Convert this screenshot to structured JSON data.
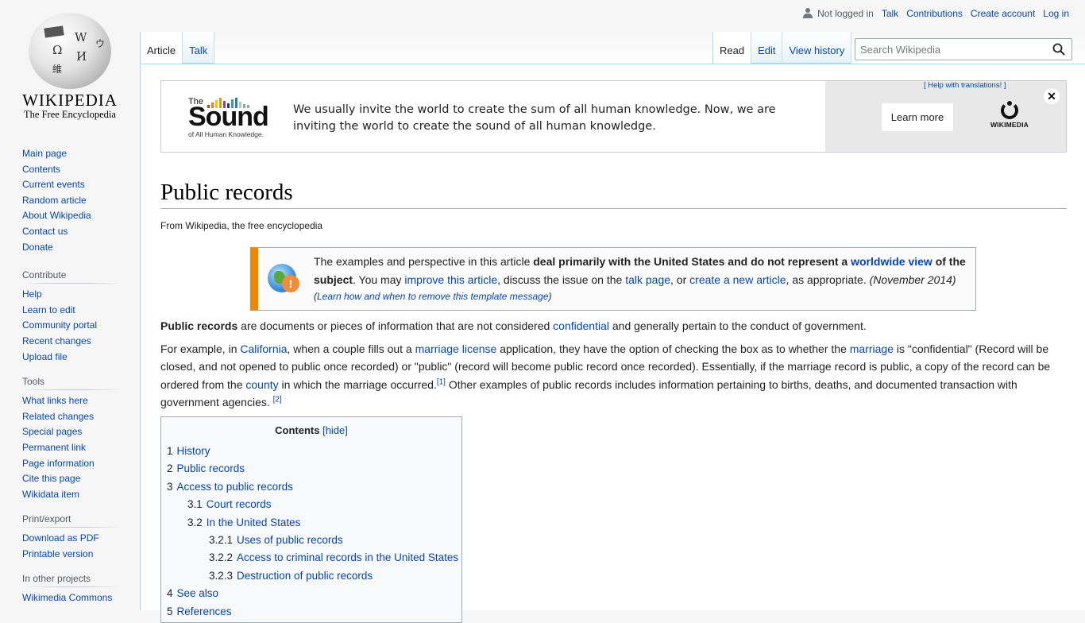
{
  "logo": {
    "wordmark": "WIKIPEDIA",
    "tagline": "The Free Encyclopedia",
    "globe_glyphs": [
      "Ω",
      "W",
      "И",
      "維",
      "ウ"
    ]
  },
  "personal": {
    "status": "Not logged in",
    "links": [
      "Talk",
      "Contributions",
      "Create account",
      "Log in"
    ]
  },
  "tabs": {
    "left": [
      {
        "label": "Article",
        "selected": true
      },
      {
        "label": "Talk",
        "selected": false
      }
    ],
    "right": [
      {
        "label": "Read",
        "selected": true
      },
      {
        "label": "Edit",
        "selected": false
      },
      {
        "label": "View history",
        "selected": false
      }
    ]
  },
  "search": {
    "placeholder": "Search Wikipedia",
    "value": ""
  },
  "sidebar": {
    "navigation": [
      "Main page",
      "Contents",
      "Current events",
      "Random article",
      "About Wikipedia",
      "Contact us",
      "Donate"
    ],
    "contribute": {
      "heading": "Contribute",
      "items": [
        "Help",
        "Learn to edit",
        "Community portal",
        "Recent changes",
        "Upload file"
      ]
    },
    "tools": {
      "heading": "Tools",
      "items": [
        "What links here",
        "Related changes",
        "Special pages",
        "Permanent link",
        "Page information",
        "Cite this page",
        "Wikidata item"
      ]
    },
    "print": {
      "heading": "Print/export",
      "items": [
        "Download as PDF",
        "Printable version"
      ]
    },
    "other_projects": {
      "heading": "In other projects",
      "items": [
        "Wikimedia Commons"
      ]
    }
  },
  "banner": {
    "logo_the": "The",
    "logo_word": "Sound",
    "logo_sub": "of All Human Knowledge.",
    "bar_colors": [
      "#c0392b",
      "#e67e22",
      "#f1c40f",
      "#d4a017",
      "#8e44ad",
      "#2c3e50",
      "#3498db",
      "#2980b9",
      "#bdc3c7",
      "#95a5a6",
      "#7fb3a0"
    ],
    "message": "We usually invite the world to create the sum of all human knowledge. Now, we are inviting the world to create the sound of all human knowledge.",
    "help_link": "[ Help with translations! ]",
    "learn_more": "Learn more",
    "org": "WIKIMEDIA",
    "close": "✕"
  },
  "article": {
    "title": "Public records",
    "site_sub": "From Wikipedia, the free encyclopedia"
  },
  "ambox": {
    "t1": "The examples and perspective in this article ",
    "bold1": "deal primarily with the United States and do not represent a ",
    "link1": "worldwide view",
    "bold2": " of the subject",
    "t2": ". You may ",
    "link2": "improve this article",
    "t3": ", discuss the issue on the ",
    "link3": "talk page",
    "t4": ", or ",
    "link4": "create a new article",
    "t5": ", as appropriate. ",
    "date": "(November 2014)",
    "learn_open": "(",
    "learn_link": "Learn how and when to remove this template message",
    "learn_close": ")",
    "warn_glyph": "!"
  },
  "para1": {
    "bold": "Public records",
    "t1": " are documents or pieces of information that are not considered ",
    "link1": "confidential",
    "t2": " and generally pertain to the conduct of government."
  },
  "para2": {
    "t1": "For example, in ",
    "link1": "California",
    "t2": ", when a couple fills out a ",
    "link2": "marriage license",
    "t3": " application, they have the option of checking the box as to whether the ",
    "link3": "marriage",
    "t4": " is \"confidential\" (Record will be closed, and not opened to public once recorded) or \"public\" (record will become public record once recorded). Essentially, if the marriage record is public, a copy of the record can be ordered from the ",
    "link4": "county",
    "t5": " in which the marriage occurred.",
    "ref1": "[1]",
    "t6": " Other examples of public records includes information pertaining to births, deaths, and documented transaction with government agencies. ",
    "ref2": "[2]"
  },
  "toc": {
    "title": "Contents",
    "toggle": "[hide]",
    "items": [
      {
        "num": "1",
        "label": "History",
        "level": 1
      },
      {
        "num": "2",
        "label": "Public records",
        "level": 1
      },
      {
        "num": "3",
        "label": "Access to public records",
        "level": 1
      },
      {
        "num": "3.1",
        "label": "Court records",
        "level": 2
      },
      {
        "num": "3.2",
        "label": "In the United States",
        "level": 2
      },
      {
        "num": "3.2.1",
        "label": "Uses of public records",
        "level": 3
      },
      {
        "num": "3.2.2",
        "label": "Access to criminal records in the United States",
        "level": 3
      },
      {
        "num": "3.2.3",
        "label": "Destruction of public records",
        "level": 3
      },
      {
        "num": "4",
        "label": "See also",
        "level": 1
      },
      {
        "num": "5",
        "label": "References",
        "level": 1
      }
    ]
  },
  "colors": {
    "link": "#0645ad",
    "ambox_accent": "#f28500",
    "tab_border": "#a7d7f9"
  }
}
